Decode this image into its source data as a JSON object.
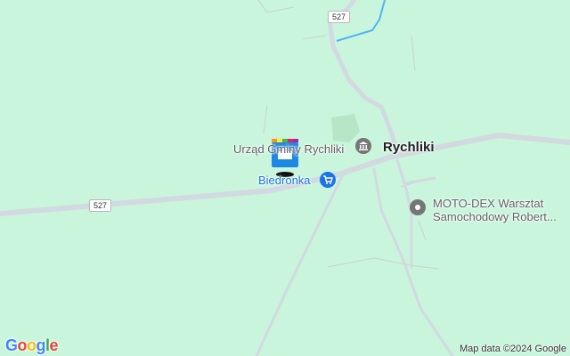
{
  "map": {
    "road_shields": [
      "527",
      "527"
    ],
    "town_label": "Rychliki",
    "pois": [
      {
        "label": "Urząd Gminy Rychliki",
        "kind": "government-building",
        "color": "#5f6368"
      },
      {
        "label": "Biedronka",
        "kind": "shopping-cart",
        "color": "#1a73e8"
      },
      {
        "label_line1": "MOTO-DEX Warsztat",
        "label_line2": "Samochodowy Robert...",
        "kind": "place-pin",
        "color": "#5f6368"
      }
    ],
    "marker_icon": "transit-marker-icon"
  },
  "branding": {
    "logo_letters": [
      "G",
      "o",
      "o",
      "g",
      "l",
      "e"
    ],
    "logo_colors": [
      "#4285F4",
      "#EA4335",
      "#FBBC05",
      "#4285F4",
      "#34A853",
      "#EA4335"
    ],
    "attribution": "Map data ©2024 Google"
  },
  "colors": {
    "land": "#c9f5dc",
    "road": "#d6dbe1",
    "water": "#4fb3f6",
    "park": "#b6e6c6"
  }
}
